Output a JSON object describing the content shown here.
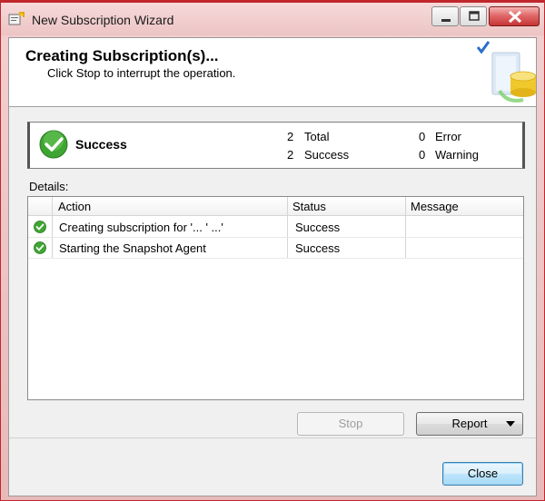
{
  "window": {
    "title": "New Subscription Wizard",
    "icon": "wizard-app-icon",
    "controls": [
      "minimize-icon",
      "maximize-icon",
      "close-icon"
    ]
  },
  "header": {
    "title": "Creating Subscription(s)...",
    "subtitle": "Click Stop to interrupt the operation.",
    "art_icon": "database-checkmark-icon"
  },
  "summary": {
    "status": "Success",
    "total_count": "2",
    "total_label": "Total",
    "success_count": "2",
    "success_label": "Success",
    "error_count": "0",
    "error_label": "Error",
    "warning_count": "0",
    "warning_label": "Warning"
  },
  "details": {
    "label": "Details:",
    "columns": [
      "Action",
      "Status",
      "Message"
    ],
    "rows": [
      {
        "icon": "success-icon",
        "action": "Creating subscription for '...  '  ...'",
        "status": "Success",
        "message": ""
      },
      {
        "icon": "success-icon",
        "action": "Starting the Snapshot Agent",
        "status": "Success",
        "message": ""
      }
    ]
  },
  "buttons": {
    "stop": "Stop",
    "report": "Report",
    "close": "Close"
  },
  "colors": {
    "title_bar": "#edc4c4",
    "close_button": "#c73434",
    "success_green": "#3fa532",
    "default_button": "#a7d9f5"
  }
}
